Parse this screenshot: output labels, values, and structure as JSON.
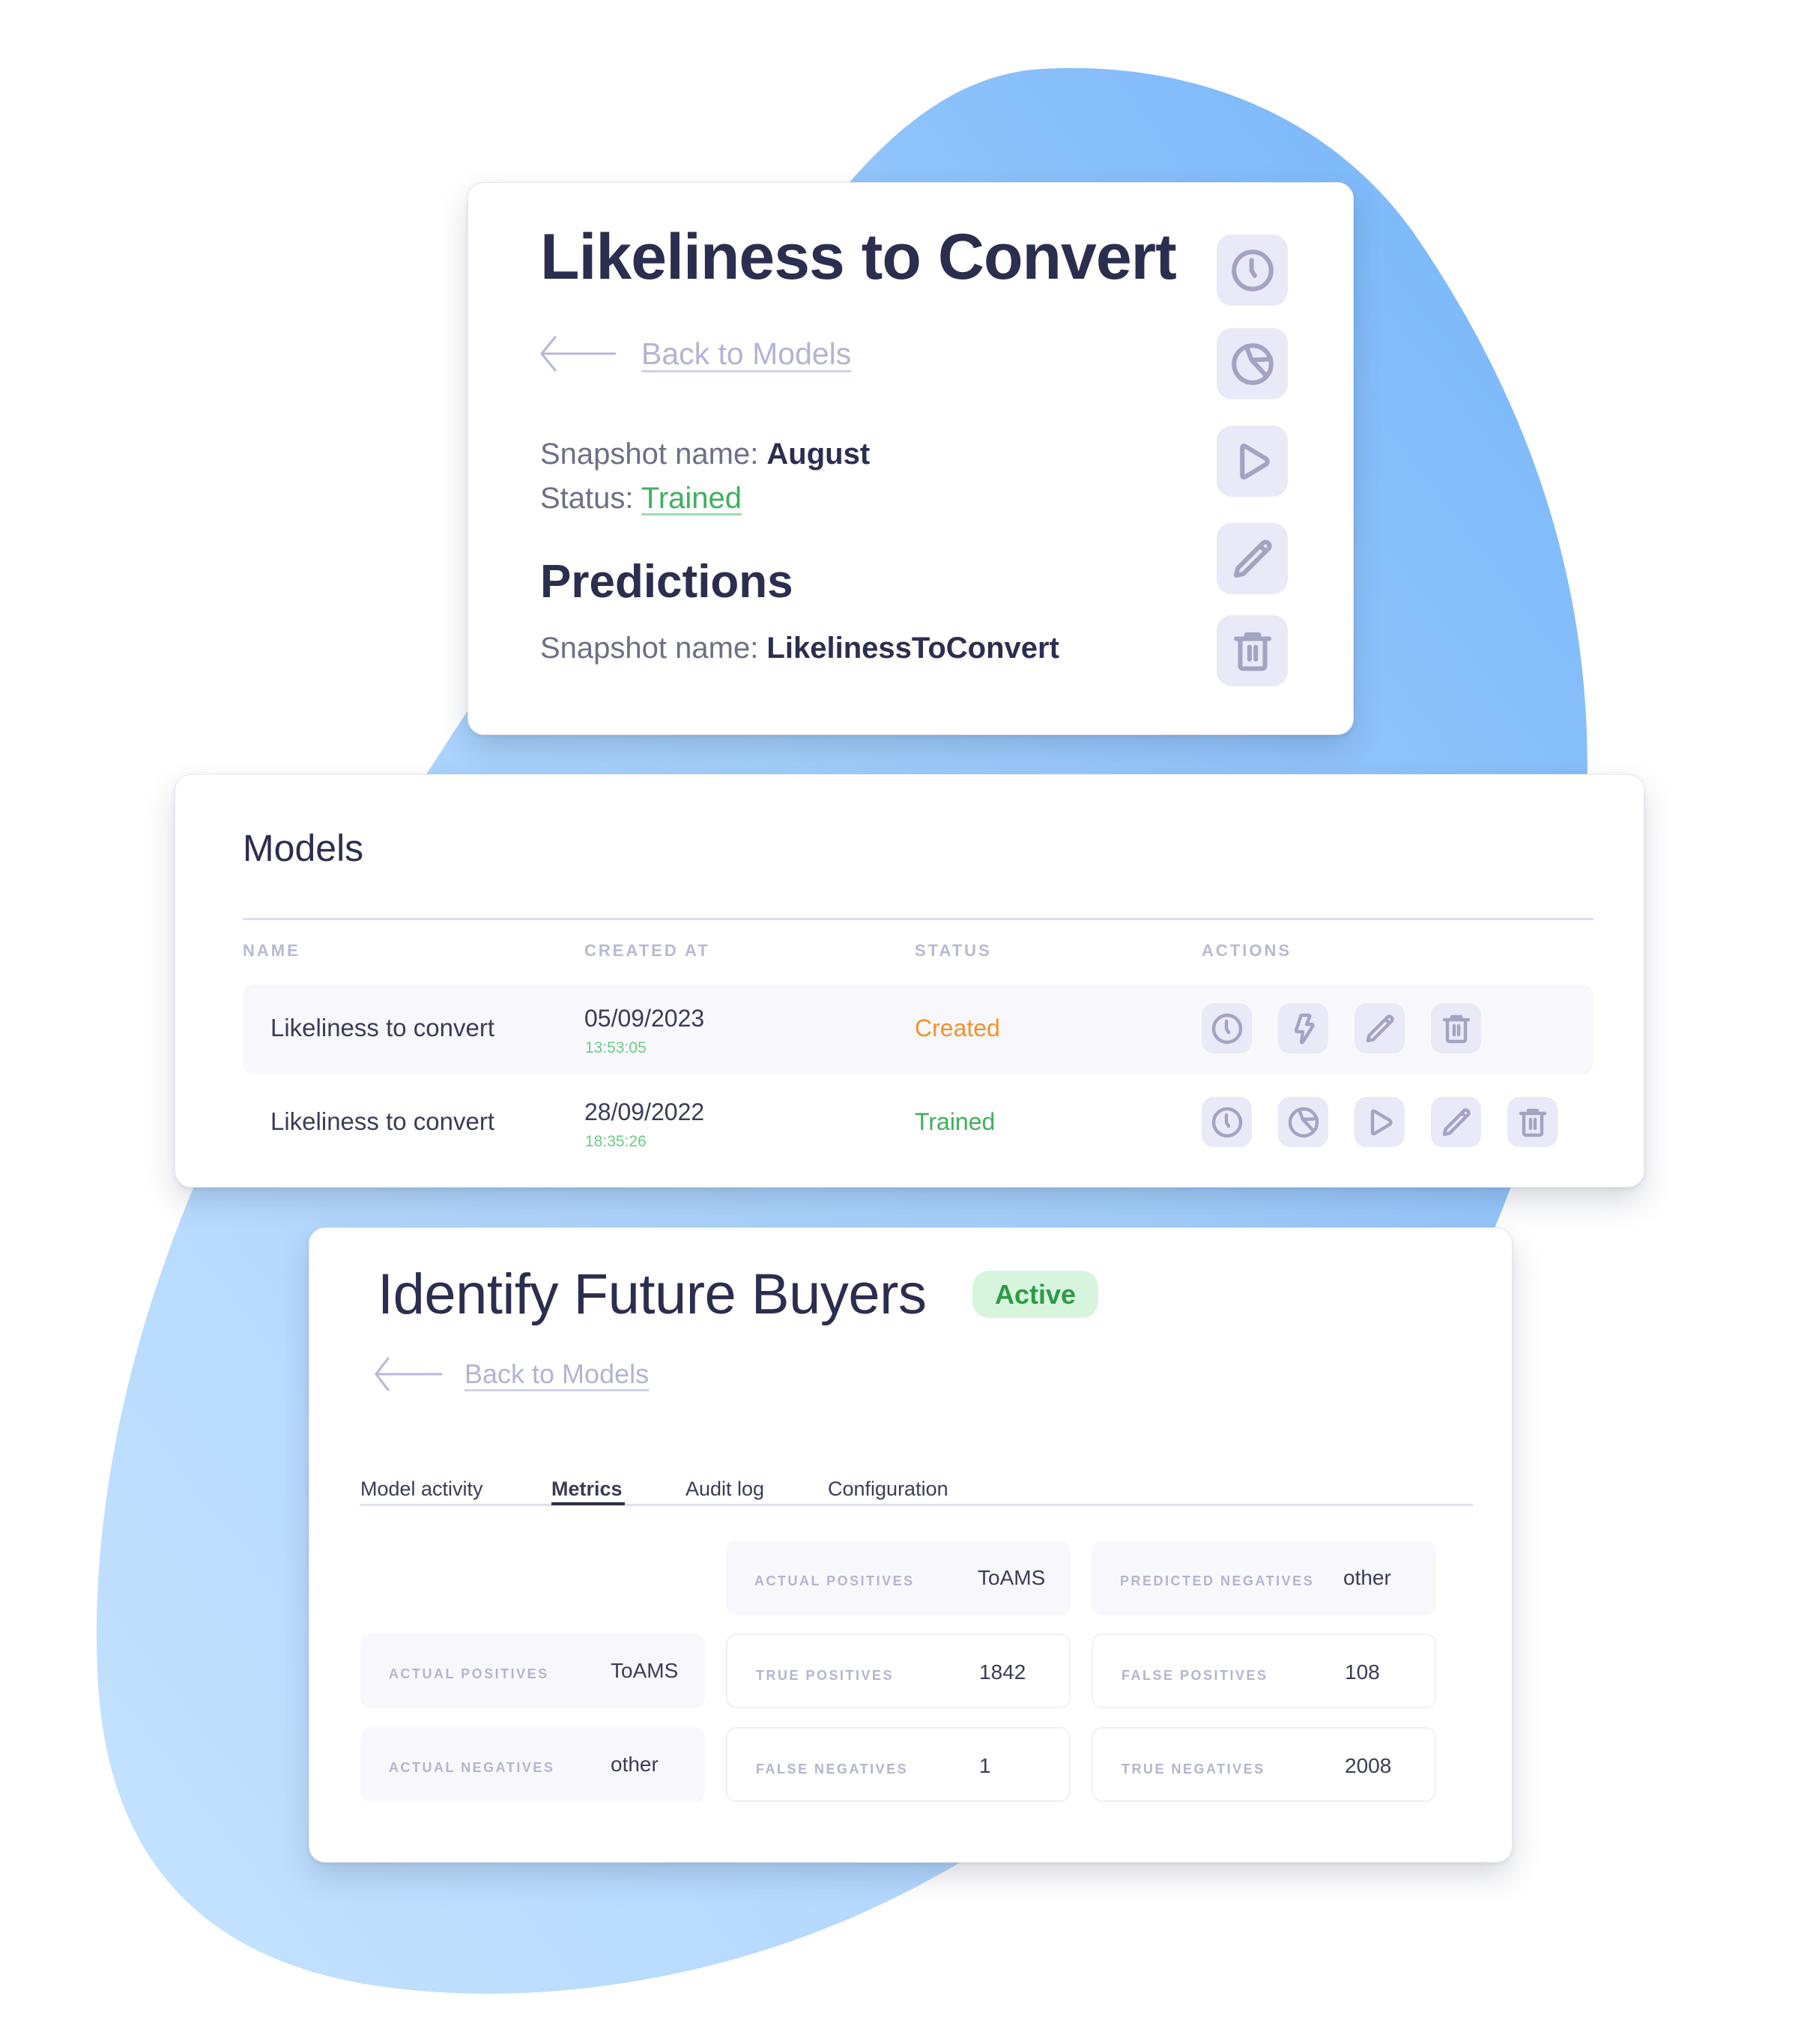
{
  "colors": {
    "blob_light": "#c4e0fe",
    "blob_dark": "#77b6fa",
    "title": "#2c2e4f",
    "link": "#b3b4d3",
    "trained": "#3cb15c",
    "created": "#f5902a",
    "active_badge_bg": "#d7f5dd",
    "active_badge_text": "#2e9a48",
    "icon_button_bg": "#e9e9f7",
    "icon_stroke": "#a3a3c2"
  },
  "snapshot_card": {
    "title": "Likeliness to Convert",
    "back_link": "Back to Models",
    "snapshot_label": "Snapshot name: ",
    "snapshot_value": "August",
    "status_label": "Status: ",
    "status_value": "Trained",
    "predictions_heading": "Predictions",
    "predictions_snapshot_label": "Snapshot name: ",
    "predictions_snapshot_value": "LikelinessToConvert",
    "actions": [
      "clock-icon",
      "pie-chart-icon",
      "play-icon",
      "pencil-icon",
      "trash-icon"
    ]
  },
  "models_card": {
    "title": "Models",
    "columns": [
      "NAME",
      "CREATED AT",
      "STATUS",
      "ACTIONS"
    ],
    "rows": [
      {
        "name": "Likeliness to convert",
        "date": "05/09/2023",
        "time": "13:53:05",
        "status": "Created",
        "actions": [
          "clock-icon",
          "lightning-icon",
          "pencil-icon",
          "trash-icon"
        ]
      },
      {
        "name": "Likeliness to convert",
        "date": "28/09/2022",
        "time": "18:35:26",
        "status": "Trained",
        "actions": [
          "clock-icon",
          "pie-chart-icon",
          "play-icon",
          "pencil-icon",
          "trash-icon"
        ]
      }
    ]
  },
  "metrics_card": {
    "title": "Identify Future Buyers",
    "badge": "Active",
    "back_link": "Back to Models",
    "tabs": [
      {
        "label": "Model activity",
        "active": false
      },
      {
        "label": "Metrics",
        "active": true
      },
      {
        "label": "Audit log",
        "active": false
      },
      {
        "label": "Configuration",
        "active": false
      }
    ],
    "matrix": {
      "header": [
        {
          "label": "ACTUAL POSITIVES",
          "value": "ToAMS"
        },
        {
          "label": "PREDICTED NEGATIVES",
          "value": "other"
        }
      ],
      "rows": [
        {
          "row_header": {
            "label": "ACTUAL POSITIVES",
            "value": "ToAMS"
          },
          "cells": [
            {
              "label": "TRUE POSITIVES",
              "value": "1842"
            },
            {
              "label": "FALSE POSITIVES",
              "value": "108"
            }
          ]
        },
        {
          "row_header": {
            "label": "ACTUAL NEGATIVES",
            "value": "other"
          },
          "cells": [
            {
              "label": "FALSE NEGATIVES",
              "value": "1"
            },
            {
              "label": "TRUE NEGATIVES",
              "value": "2008"
            }
          ]
        }
      ]
    }
  }
}
